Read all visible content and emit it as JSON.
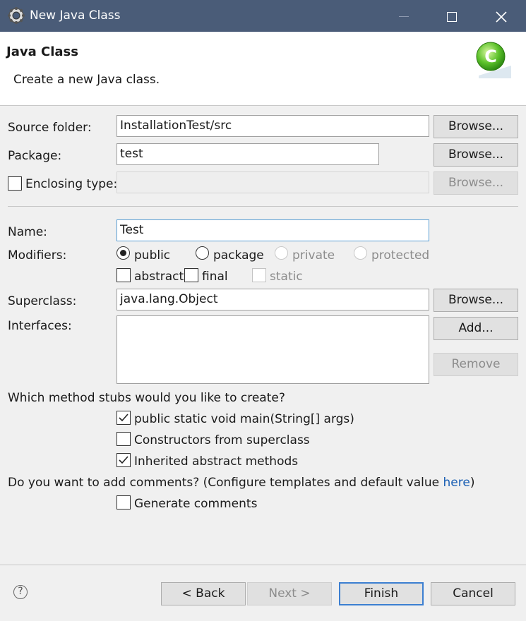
{
  "window": {
    "title": "New Java Class",
    "controls": [
      "minimize",
      "maximize",
      "close"
    ]
  },
  "header": {
    "title": "Java Class",
    "description": "Create a new Java class."
  },
  "source_folder": {
    "label": "Source folder:",
    "value": "InstallationTest/src",
    "button": "Browse..."
  },
  "package": {
    "label": "Package:",
    "value": "test",
    "button": "Browse..."
  },
  "enclosing_type": {
    "label": "Enclosing type:",
    "checked": false,
    "value": "",
    "button": "Browse..."
  },
  "name": {
    "label": "Name:",
    "value": "Test"
  },
  "modifiers": {
    "label": "Modifiers:",
    "options": [
      "public",
      "package",
      "private",
      "protected"
    ],
    "selected": "public",
    "abstract": "abstract",
    "final": "final",
    "static": "static"
  },
  "superclass": {
    "label": "Superclass:",
    "value": "java.lang.Object",
    "button": "Browse..."
  },
  "interfaces": {
    "label": "Interfaces:",
    "add_button": "Add...",
    "remove_button": "Remove"
  },
  "stubs": {
    "question": "Which method stubs would you like to create?",
    "main": {
      "label": "public static void main(String[] args)",
      "checked": true
    },
    "constructors": {
      "label": "Constructors from superclass",
      "checked": false
    },
    "inherited": {
      "label": "Inherited abstract methods",
      "checked": true
    }
  },
  "comments": {
    "question": "Do you want to add comments? (Configure templates and default value ",
    "link": "here",
    "suffix": ")",
    "generate": {
      "label": "Generate comments",
      "checked": false
    }
  },
  "footer": {
    "back": "< Back",
    "next": "Next >",
    "finish": "Finish",
    "cancel": "Cancel"
  }
}
